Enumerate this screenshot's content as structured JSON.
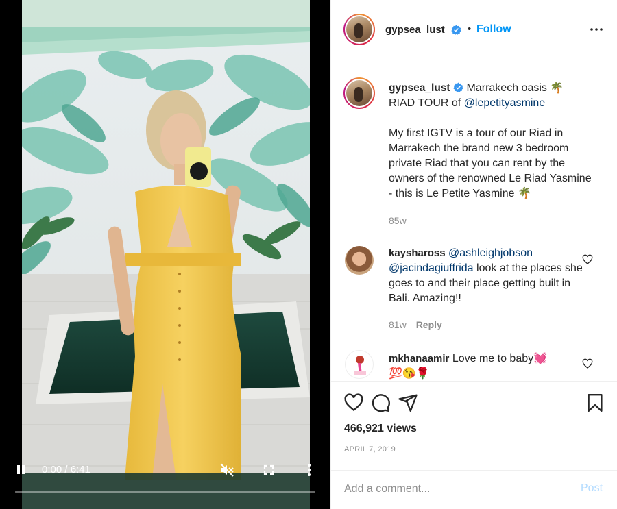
{
  "video": {
    "time_display": "0:00 / 6:41",
    "progress": 0,
    "icons": {
      "play": "pause-icon",
      "mute": "muted-speaker-icon",
      "fullscreen": "fullscreen-icon",
      "menu": "vertical-dots-icon"
    }
  },
  "header": {
    "username": "gypsea_lust",
    "separator": "•",
    "follow_label": "Follow",
    "verified": true
  },
  "caption": {
    "username": "gypsea_lust",
    "line1_text": "Marrakech oasis 🌴",
    "line2_text": "RIAD TOUR of ",
    "mention": "@lepetityasmine",
    "body": "My first IGTV is a tour of our Riad in Marrakech the brand new 3 bedroom private Riad that you can rent by the owners of the renowned Le Riad Yasmine - this is Le Petite Yasmine 🌴",
    "age": "85w"
  },
  "comments": [
    {
      "username": "kayshaross",
      "mention1": "@ashleighjobson",
      "mention2": "@jacindagiuffrida",
      "text": " look at the places she goes to and their place getting built in Bali. Amazing!!",
      "age": "81w",
      "reply_label": "Reply"
    },
    {
      "username": "mkhanaamir",
      "text": "Love me to baby💓",
      "text2": "💯😘🌹"
    }
  ],
  "actions": {
    "views": "466,921 views",
    "date": "APRIL 7, 2019",
    "icons": [
      "heart-icon",
      "comment-icon",
      "share-icon",
      "bookmark-icon"
    ]
  },
  "add_comment": {
    "placeholder": "Add a comment...",
    "post_label": "Post"
  },
  "colors": {
    "accent": "#0095f6",
    "mention": "#00376b",
    "muted": "#8e8e8e",
    "post_disabled": "#b3dbff",
    "dress": "#f2c94c"
  }
}
